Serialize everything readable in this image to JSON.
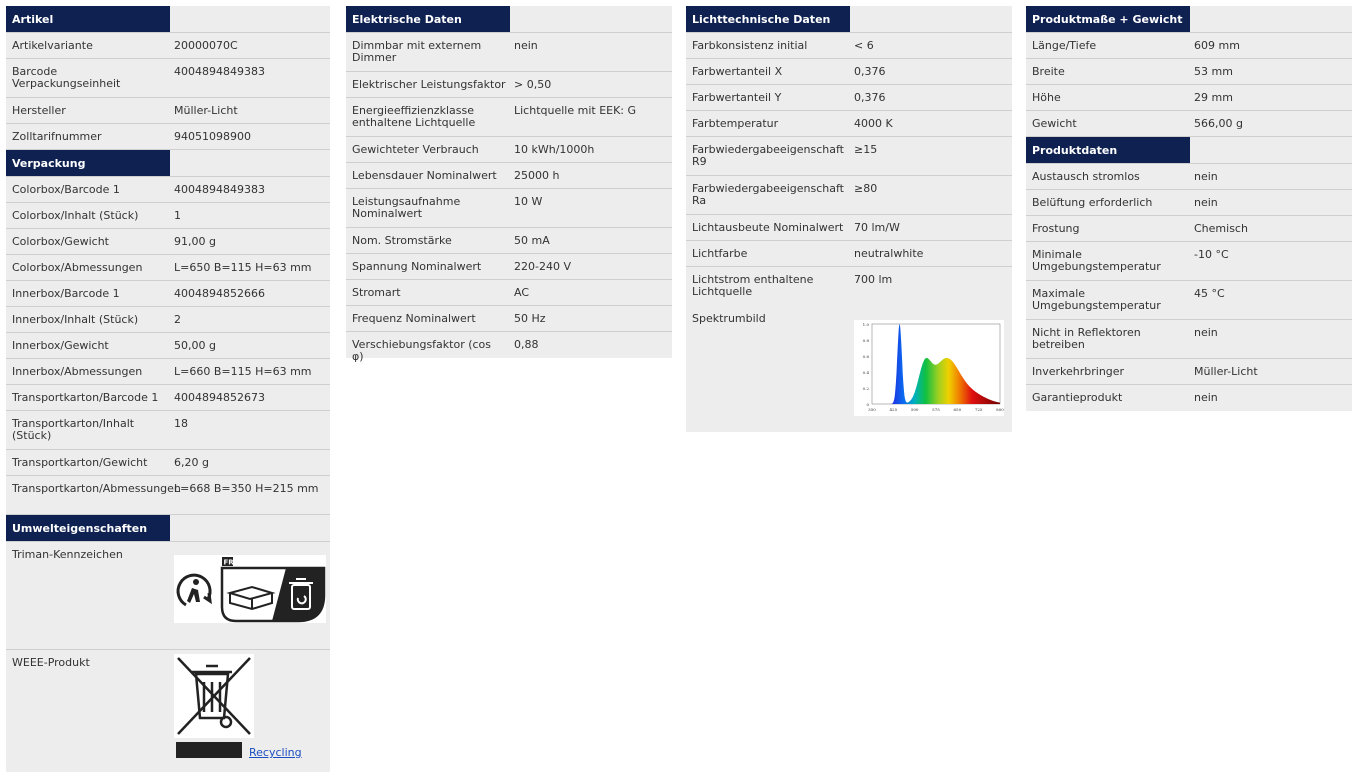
{
  "col1": {
    "artikel": {
      "title": "Artikel",
      "rows": [
        {
          "label": "Artikelvariante",
          "value": "20000070C"
        },
        {
          "label": "Barcode Verpackungseinheit",
          "value": "4004894849383"
        },
        {
          "label": "Hersteller",
          "value": "Müller-Licht"
        },
        {
          "label": "Zolltarifnummer",
          "value": "94051098900"
        }
      ]
    },
    "verpackung": {
      "title": "Verpackung",
      "rows": [
        {
          "label": "Colorbox/Barcode 1",
          "value": "4004894849383"
        },
        {
          "label": "Colorbox/Inhalt (Stück)",
          "value": "1"
        },
        {
          "label": "Colorbox/Gewicht",
          "value": "91,00 g"
        },
        {
          "label": "Colorbox/Abmessungen",
          "value": "L=650 B=115 H=63 mm"
        },
        {
          "label": "Innerbox/Barcode 1",
          "value": "4004894852666"
        },
        {
          "label": "Innerbox/Inhalt (Stück)",
          "value": "2"
        },
        {
          "label": "Innerbox/Gewicht",
          "value": "50,00 g"
        },
        {
          "label": "Innerbox/Abmessungen",
          "value": "L=660 B=115 H=63 mm"
        },
        {
          "label": "Transportkarton/Barcode 1",
          "value": "4004894852673"
        },
        {
          "label": "Transportkarton/Inhalt (Stück)",
          "value": "18"
        },
        {
          "label": "Transportkarton/Gewicht",
          "value": "6,20 g"
        },
        {
          "label": "Transportkarton/Abmessungen",
          "value": "L=668 B=350 H=215 mm"
        }
      ]
    },
    "umwelt": {
      "title": "Umwelteigenschaften",
      "triman_label": "Triman-Kennzeichen",
      "triman_badge": "FR",
      "weee_label": "WEEE-Produkt",
      "recycling_link": "Recycling"
    }
  },
  "col2": {
    "title": "Elektrische Daten",
    "rows": [
      {
        "label": "Dimmbar mit externem Dimmer",
        "value": "nein"
      },
      {
        "label": "Elektrischer Leistungsfaktor",
        "value": "> 0,50"
      },
      {
        "label": "Energieeffizienzklasse enthaltene Lichtquelle",
        "value": "Lichtquelle mit EEK: G"
      },
      {
        "label": "Gewichteter Verbrauch",
        "value": "10 kWh/1000h"
      },
      {
        "label": "Lebensdauer Nominalwert",
        "value": "25000 h"
      },
      {
        "label": "Leistungsaufnahme Nominalwert",
        "value": "10 W"
      },
      {
        "label": "Nom. Stromstärke",
        "value": "50 mA"
      },
      {
        "label": "Spannung Nominalwert",
        "value": "220-240 V"
      },
      {
        "label": "Stromart",
        "value": "AC"
      },
      {
        "label": "Frequenz Nominalwert",
        "value": "50 Hz"
      },
      {
        "label": "Verschiebungsfaktor (cos φ)",
        "value": "0,88"
      }
    ]
  },
  "col3": {
    "title": "Lichttechnische Daten",
    "rows": [
      {
        "label": "Farbkonsistenz initial",
        "value": "< 6"
      },
      {
        "label": "Farbwertanteil X",
        "value": "0,376"
      },
      {
        "label": "Farbwertanteil Y",
        "value": "0,376"
      },
      {
        "label": "Farbtemperatur",
        "value": "4000 K"
      },
      {
        "label": "Farbwiedergabeeigenschaft R9",
        "value": "≥15"
      },
      {
        "label": "Farbwiedergabeeigenschaft Ra",
        "value": "≥80"
      },
      {
        "label": "Lichtausbeute Nominalwert",
        "value": "70 lm/W"
      },
      {
        "label": "Lichtfarbe",
        "value": "neutralwhite"
      },
      {
        "label": "Lichtstrom enthaltene Lichtquelle",
        "value": "700 lm"
      }
    ],
    "spektrum_label": "Spektrumbild",
    "spektrum": {
      "y_ticks": [
        "0",
        "0.2",
        "0.4",
        "0.6",
        "0.8",
        "1.0"
      ],
      "x_ticks": [
        "350",
        "425",
        "500",
        "575",
        "650",
        "725",
        "800"
      ]
    }
  },
  "col4": {
    "masse": {
      "title": "Produktmaße + Gewicht",
      "rows": [
        {
          "label": "Länge/Tiefe",
          "value": "609 mm"
        },
        {
          "label": "Breite",
          "value": "53 mm"
        },
        {
          "label": "Höhe",
          "value": "29 mm"
        },
        {
          "label": "Gewicht",
          "value": "566,00 g"
        }
      ]
    },
    "produktdaten": {
      "title": "Produktdaten",
      "rows": [
        {
          "label": "Austausch stromlos",
          "value": "nein"
        },
        {
          "label": "Belüftung erforderlich",
          "value": "nein"
        },
        {
          "label": "Frostung",
          "value": "Chemisch"
        },
        {
          "label": "Minimale Umgebungstemperatur",
          "value": "-10 °C"
        },
        {
          "label": "Maximale Umgebungstemperatur",
          "value": "45 °C"
        },
        {
          "label": "Nicht in Reflektoren betreiben",
          "value": "nein"
        },
        {
          "label": "Inverkehrbringer",
          "value": "Müller-Licht"
        },
        {
          "label": "Garantieprodukt",
          "value": "nein"
        }
      ]
    }
  }
}
